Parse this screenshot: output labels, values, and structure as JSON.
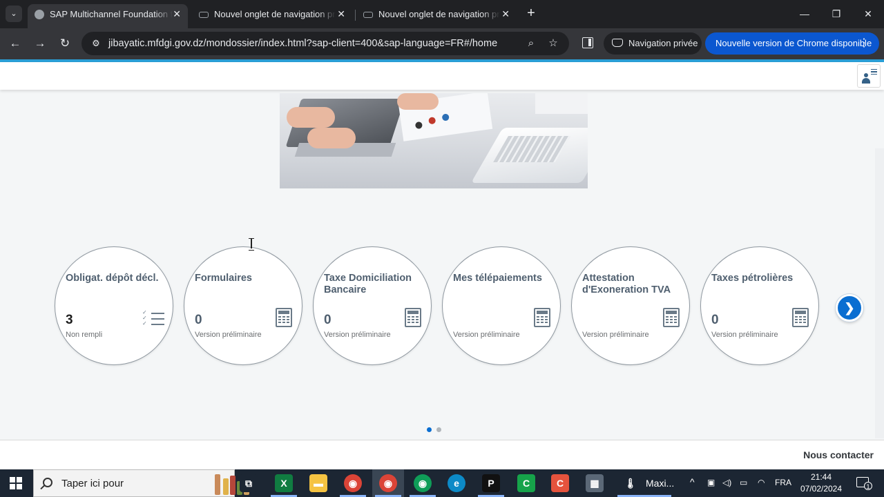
{
  "browser": {
    "tabs": [
      {
        "title": "SAP Multichannel Foundation f",
        "active": true
      },
      {
        "title": "Nouvel onglet de navigation pr",
        "active": false
      },
      {
        "title": "Nouvel onglet de navigation pr",
        "active": false
      }
    ],
    "new_tab_label": "+",
    "url": "jibayatic.mfdgi.gov.dz/mondossier/index.html?sap-client=400&sap-language=FR#/home",
    "incognito_label": "Navigation privée",
    "update_label": "Nouvelle version de Chrome disponible",
    "icons": {
      "back": "←",
      "forward": "→",
      "reload": "↻",
      "site_info": "⚙",
      "zoom": "⌕",
      "star": "☆",
      "menu": "⋮",
      "minimize": "—",
      "restore": "❐",
      "close": "✕",
      "tab_close": "✕",
      "tab_search": "⌄"
    }
  },
  "tiles": [
    {
      "title": "Obligat. dépôt décl.",
      "number": "3",
      "subtitle": "Non rempli",
      "icon": "checklist-icon"
    },
    {
      "title": "Formulaires",
      "number": "0",
      "subtitle": "Version préliminaire",
      "icon": "form-icon"
    },
    {
      "title": "Taxe Domiciliation Bancaire",
      "number": "0",
      "subtitle": "Version préliminaire",
      "icon": "form-icon"
    },
    {
      "title": "Mes télépaiements",
      "number": "",
      "subtitle": "Version préliminaire",
      "icon": "form-icon"
    },
    {
      "title": "Attestation d'Exoneration TVA",
      "number": "",
      "subtitle": "Version préliminaire",
      "icon": "form-icon"
    },
    {
      "title": "Taxes pétrolières",
      "number": "0",
      "subtitle": "Version préliminaire",
      "icon": "form-icon"
    }
  ],
  "carousel": {
    "next_label": "❯",
    "pages": 2,
    "current_page": 1,
    "colors": {
      "active": "#0a6ed1",
      "inactive": "#b0b6bb"
    }
  },
  "footer": {
    "contact_label": "Nous contacter"
  },
  "taskbar": {
    "search_placeholder": "Taper ici pour",
    "app_label": "Maxi...",
    "language": "FRA",
    "time": "21:44",
    "date": "07/02/2024",
    "notifications": "1",
    "apps": [
      {
        "name": "task-view",
        "glyph": "⧉",
        "color": "#1c2633"
      },
      {
        "name": "excel",
        "glyph": "X",
        "color": "#107c41"
      },
      {
        "name": "file-explorer",
        "glyph": "▬",
        "color": "#f5c342"
      },
      {
        "name": "chrome",
        "glyph": "◉",
        "color": "#db4437"
      },
      {
        "name": "chrome-profile",
        "glyph": "◉",
        "color": "#db4437"
      },
      {
        "name": "chrome-2",
        "glyph": "◉",
        "color": "#0f9d58"
      },
      {
        "name": "edge",
        "glyph": "e",
        "color": "#0c8ac7"
      },
      {
        "name": "pycharm",
        "glyph": "P",
        "color": "#111111"
      },
      {
        "name": "camtasia",
        "glyph": "C",
        "color": "#16a34a"
      },
      {
        "name": "camtasia-recorder",
        "glyph": "C",
        "color": "#e5533d"
      },
      {
        "name": "calculator",
        "glyph": "▦",
        "color": "#5b6877"
      },
      {
        "name": "thermometer",
        "glyph": "🌡",
        "color": "#1c2633"
      }
    ]
  }
}
